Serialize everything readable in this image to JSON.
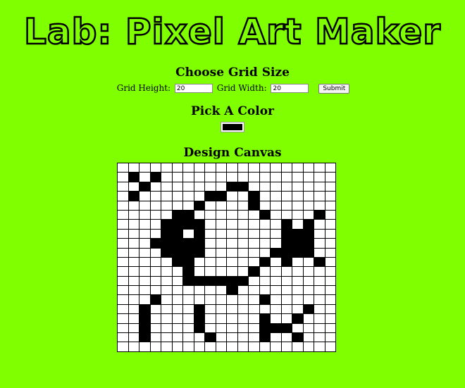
{
  "page": {
    "title": "Lab: Pixel Art Maker"
  },
  "grid_size": {
    "heading": "Choose Grid Size",
    "height_label": "Grid Height:",
    "height_value": "20",
    "width_label": "Grid Width:",
    "width_value": "20",
    "submit_label": "Submit"
  },
  "color": {
    "heading": "Pick A Color",
    "value": "#000000"
  },
  "canvas": {
    "heading": "Design Canvas",
    "rows": 20,
    "cols": 20,
    "cell_color": "#000000",
    "filled_cells": [
      [
        1,
        1
      ],
      [
        1,
        3
      ],
      [
        2,
        2
      ],
      [
        2,
        10
      ],
      [
        2,
        11
      ],
      [
        3,
        1
      ],
      [
        3,
        8
      ],
      [
        3,
        9
      ],
      [
        3,
        12
      ],
      [
        4,
        7
      ],
      [
        4,
        12
      ],
      [
        5,
        5
      ],
      [
        5,
        6
      ],
      [
        5,
        13
      ],
      [
        5,
        18
      ],
      [
        6,
        4
      ],
      [
        6,
        5
      ],
      [
        6,
        6
      ],
      [
        6,
        7
      ],
      [
        6,
        15
      ],
      [
        6,
        17
      ],
      [
        7,
        4
      ],
      [
        7,
        5
      ],
      [
        7,
        7
      ],
      [
        7,
        15
      ],
      [
        7,
        16
      ],
      [
        7,
        17
      ],
      [
        8,
        3
      ],
      [
        8,
        4
      ],
      [
        8,
        5
      ],
      [
        8,
        6
      ],
      [
        8,
        7
      ],
      [
        8,
        15
      ],
      [
        8,
        16
      ],
      [
        8,
        17
      ],
      [
        9,
        4
      ],
      [
        9,
        5
      ],
      [
        9,
        6
      ],
      [
        9,
        7
      ],
      [
        9,
        14
      ],
      [
        9,
        15
      ],
      [
        9,
        16
      ],
      [
        9,
        17
      ],
      [
        10,
        5
      ],
      [
        10,
        6
      ],
      [
        10,
        13
      ],
      [
        10,
        15
      ],
      [
        10,
        18
      ],
      [
        11,
        6
      ],
      [
        11,
        12
      ],
      [
        12,
        6
      ],
      [
        12,
        7
      ],
      [
        12,
        8
      ],
      [
        12,
        9
      ],
      [
        12,
        10
      ],
      [
        12,
        11
      ],
      [
        13,
        10
      ],
      [
        14,
        3
      ],
      [
        14,
        13
      ],
      [
        15,
        2
      ],
      [
        15,
        7
      ],
      [
        15,
        17
      ],
      [
        16,
        2
      ],
      [
        16,
        7
      ],
      [
        16,
        13
      ],
      [
        16,
        16
      ],
      [
        17,
        2
      ],
      [
        17,
        7
      ],
      [
        17,
        13
      ],
      [
        17,
        14
      ],
      [
        17,
        15
      ],
      [
        18,
        2
      ],
      [
        18,
        8
      ],
      [
        18,
        13
      ],
      [
        18,
        16
      ]
    ]
  }
}
